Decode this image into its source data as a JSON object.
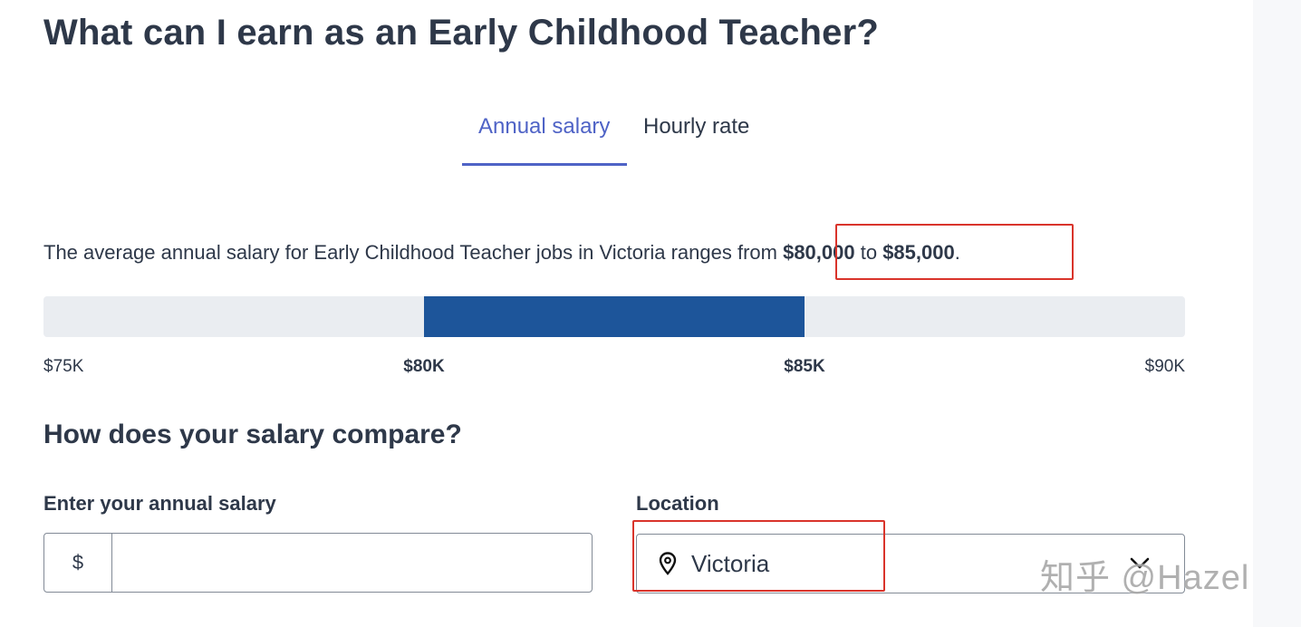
{
  "page": {
    "title": "What can I earn as an Early Childhood Teacher?"
  },
  "tabs": [
    {
      "label": "Annual salary",
      "active": true
    },
    {
      "label": "Hourly rate",
      "active": false
    }
  ],
  "summary": {
    "prefix": "The average annual salary for Early Childhood Teacher jobs in Victoria ranges from ",
    "low": "$80,000",
    "middle": " to ",
    "high": "$85,000",
    "suffix": "."
  },
  "salary_range": {
    "scale_min": 75000,
    "scale_max": 90000,
    "range_low": 80000,
    "range_high": 85000,
    "labels": {
      "min": "$75K",
      "low": "$80K",
      "high": "$85K",
      "max": "$90K"
    }
  },
  "compare": {
    "title": "How does your salary compare?",
    "salary_label": "Enter your annual salary",
    "currency_prefix": "$",
    "salary_value": "",
    "salary_placeholder": "",
    "location_label": "Location",
    "location_value": "Victoria"
  },
  "icons": {
    "location": "map-pin-icon",
    "dropdown": "chevron-down-icon"
  },
  "colors": {
    "accent_tab": "#4f63c6",
    "range_fill": "#1d559a",
    "range_track": "#eaedf1",
    "annotation_box": "#d9342b",
    "text": "#2e3849"
  },
  "watermark": {
    "text": "知乎 @Hazel"
  }
}
